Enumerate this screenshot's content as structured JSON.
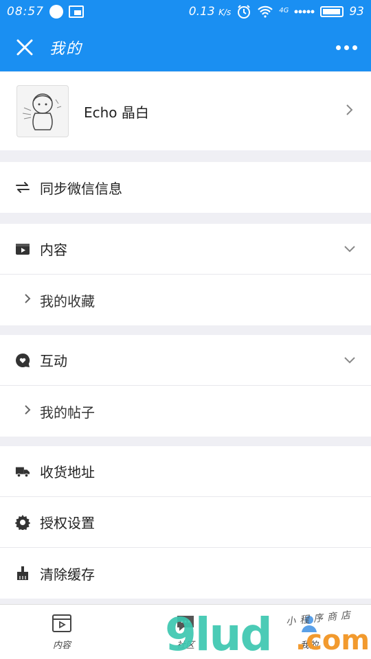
{
  "status_bar": {
    "time": "08:57",
    "net_speed": "0.13",
    "net_unit": "K/s",
    "signal_label": "4G",
    "battery_level": "93"
  },
  "nav": {
    "title": "我的"
  },
  "profile": {
    "name": "Echo 晶白"
  },
  "rows": {
    "sync": "同步微信信息",
    "content": "内容",
    "my_favorites": "我的收藏",
    "interaction": "互动",
    "my_posts": "我的帖子",
    "address": "收货地址",
    "auth": "授权设置",
    "clear_cache": "清除缓存"
  },
  "tabbar": {
    "tabs": [
      {
        "label": "内容",
        "icon": "video-icon"
      },
      {
        "label": "社区",
        "icon": "chat-icon"
      },
      {
        "label": "我的",
        "icon": "person-icon"
      }
    ]
  },
  "watermark": {
    "brand": "9lud",
    "domain": ".com",
    "tag": "小程序商店"
  },
  "colors": {
    "primary": "#1a8ff2",
    "background": "#efeff4",
    "watermark_green": "#3cc7b0",
    "watermark_orange": "#f29a2e"
  }
}
